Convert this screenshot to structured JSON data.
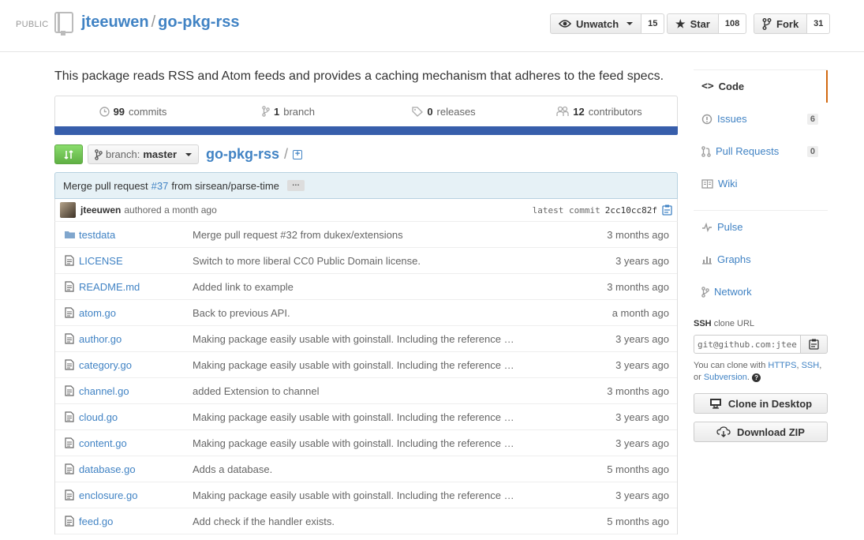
{
  "header": {
    "visibility": "PUBLIC",
    "owner": "jteeuwen",
    "separator": "/",
    "repo": "go-pkg-rss",
    "watch": {
      "label": "Unwatch",
      "count": "15"
    },
    "star": {
      "label": "Star",
      "count": "108"
    },
    "fork": {
      "label": "Fork",
      "count": "31"
    }
  },
  "description": "This package reads RSS and Atom feeds and provides a caching mechanism that adheres to the feed specs.",
  "summary": {
    "commits": {
      "num": "99",
      "label": "commits"
    },
    "branches": {
      "num": "1",
      "label": "branch"
    },
    "releases": {
      "num": "0",
      "label": "releases"
    },
    "contributors": {
      "num": "12",
      "label": "contributors"
    },
    "language_color": "#375eab"
  },
  "file_nav": {
    "branch_label": "branch:",
    "branch_name": "master",
    "path_root": "go-pkg-rss",
    "path_sep": "/"
  },
  "commit": {
    "message_prefix": "Merge pull request",
    "pr_link": "#37",
    "message_suffix": "from sirsean/parse-time",
    "ellipsis": "…",
    "author": "jteeuwen",
    "authored": "authored a month ago",
    "latest_label": "latest commit",
    "sha": "2cc10cc82f"
  },
  "files": [
    {
      "type": "folder",
      "name": "testdata",
      "message": "Merge pull request #32 from dukex/extensions",
      "age": "3 months ago"
    },
    {
      "type": "file",
      "name": "LICENSE",
      "message": "Switch to more liberal CC0 Public Domain license.",
      "age": "3 years ago"
    },
    {
      "type": "file",
      "name": "README.md",
      "message": "Added link to example",
      "age": "3 months ago"
    },
    {
      "type": "file",
      "name": "atom.go",
      "message": "Back to previous API.",
      "age": "a month ago"
    },
    {
      "type": "file",
      "name": "author.go",
      "message": "Making package easily usable with goinstall. Including the reference …",
      "age": "3 years ago"
    },
    {
      "type": "file",
      "name": "category.go",
      "message": "Making package easily usable with goinstall. Including the reference …",
      "age": "3 years ago"
    },
    {
      "type": "file",
      "name": "channel.go",
      "message": "added Extension to channel",
      "age": "3 months ago"
    },
    {
      "type": "file",
      "name": "cloud.go",
      "message": "Making package easily usable with goinstall. Including the reference …",
      "age": "3 years ago"
    },
    {
      "type": "file",
      "name": "content.go",
      "message": "Making package easily usable with goinstall. Including the reference …",
      "age": "3 years ago"
    },
    {
      "type": "file",
      "name": "database.go",
      "message": "Adds a database.",
      "age": "5 months ago"
    },
    {
      "type": "file",
      "name": "enclosure.go",
      "message": "Making package easily usable with goinstall. Including the reference …",
      "age": "3 years ago"
    },
    {
      "type": "file",
      "name": "feed.go",
      "message": "Add check if the handler exists.",
      "age": "5 months ago"
    }
  ],
  "sidebar": {
    "code": "Code",
    "issues": {
      "label": "Issues",
      "count": "6"
    },
    "pulls": {
      "label": "Pull Requests",
      "count": "0"
    },
    "wiki": "Wiki",
    "pulse": "Pulse",
    "graphs": "Graphs",
    "network": "Network",
    "clone_proto": "SSH",
    "clone_label": "clone URL",
    "clone_url": "git@github.com:jteeuwen/go-pkg-rss.git",
    "clone_help_prefix": "You can clone with",
    "https": "HTTPS",
    "ssh": "SSH",
    "subversion": "Subversion",
    "clone_desktop": "Clone in Desktop",
    "download_zip": "Download ZIP",
    "accent_color": "#d26911"
  }
}
